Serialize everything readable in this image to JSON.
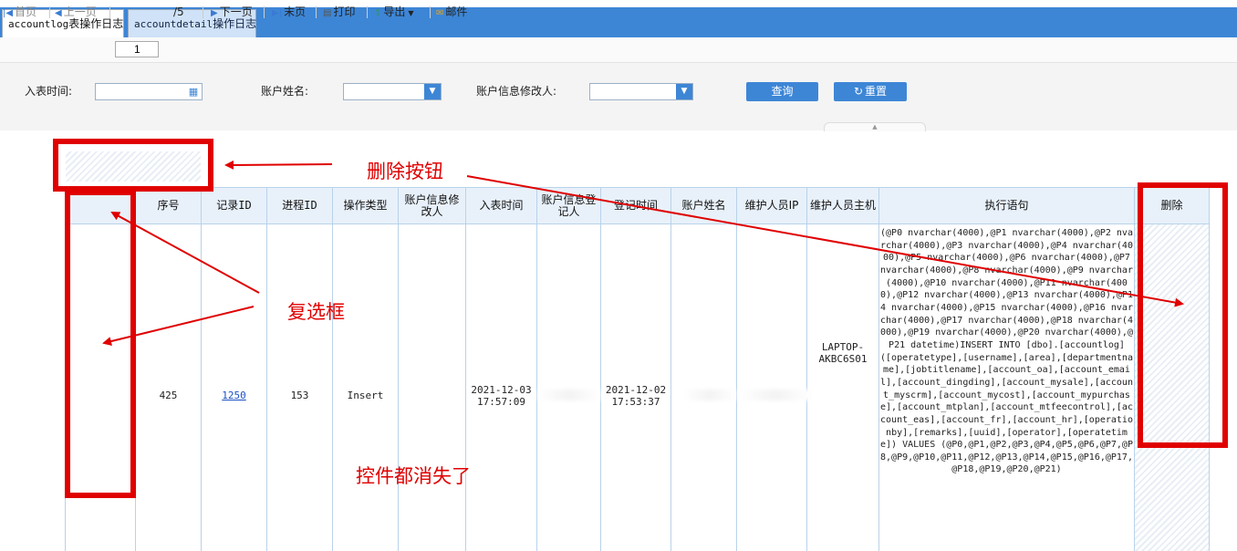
{
  "tabs": [
    {
      "prefix": "accountlog",
      "suffix": "表操作日志"
    },
    {
      "prefix": "accountdetail",
      "suffix": "操作日志"
    }
  ],
  "toolbar": {
    "first": "首页",
    "prev": "上一页",
    "page_value": "1",
    "page_total": "/5",
    "next": "下一页",
    "last": "末页",
    "print": "打印",
    "export": "导出",
    "mail": "邮件"
  },
  "filters": {
    "entry_time_label": "入表时间:",
    "account_name_label": "账户姓名:",
    "modifier_label": "账户信息修改人:",
    "query_button": "查询",
    "reset_button": "重置"
  },
  "table": {
    "headers": [
      "序号",
      "记录ID",
      "进程ID",
      "操作类型",
      "账户信息修改人",
      "入表时间",
      "账户信息登记人",
      "登记时间",
      "账户姓名",
      "维护人员IP",
      "维护人员主机",
      "执行语句",
      "删除"
    ],
    "rows": [
      {
        "seq": "425",
        "record_id": "1250",
        "process_id": "153",
        "op_type": "Insert",
        "entry_time_date": "2021-12-03",
        "entry_time_clock": "17:57:09",
        "reg_time_date": "2021-12-02",
        "reg_time_clock": "17:53:37",
        "host_line1": "LAPTOP-",
        "host_line2": "AKBC6S01",
        "statement": "(@P0 nvarchar(4000),@P1 nvarchar(4000),@P2 nvarchar(4000),@P3 nvarchar(4000),@P4 nvarchar(4000),@P5 nvarchar(4000),@P6 nvarchar(4000),@P7 nvarchar(4000),@P8 nvarchar(4000),@P9 nvarchar(4000),@P10 nvarchar(4000),@P11 nvarchar(4000),@P12 nvarchar(4000),@P13 nvarchar(4000),@P14 nvarchar(4000),@P15 nvarchar(4000),@P16 nvarchar(4000),@P17 nvarchar(4000),@P18 nvarchar(4000),@P19 nvarchar(4000),@P20 nvarchar(4000),@P21 datetime)INSERT INTO [dbo].[accountlog] ([operatetype],[username],[area],[departmentname],[jobtitlename],[account_oa],[account_email],[account_dingding],[account_mysale],[account_myscrm],[account_mycost],[account_mypurchase],[account_mtplan],[account_mtfeecontrol],[account_eas],[account_fr],[account_hr],[operationby],[remarks],[uuid],[operator],[operatetime]) VALUES (@P0,@P1,@P2,@P3,@P4,@P5,@P6,@P7,@P8,@P9,@P10,@P11,@P12,@P13,@P14,@P15,@P16,@P17,@P18,@P19,@P20,@P21)"
      }
    ]
  },
  "annotations": {
    "delete_button": "删除按钮",
    "checkbox": "复选框",
    "controls_missing": "控件都消失了"
  },
  "colors": {
    "accent": "#3d86d6",
    "annotation": "#e00000"
  }
}
